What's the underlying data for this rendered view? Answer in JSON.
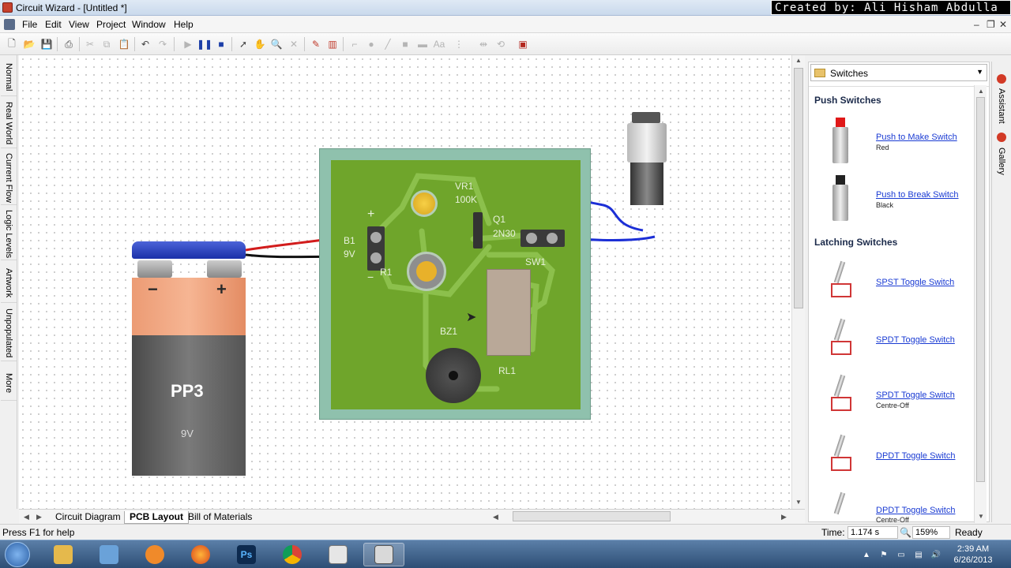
{
  "window": {
    "title": "Circuit Wizard - [Untitled *]",
    "credit": "Created by: Ali Hisham Abdulla"
  },
  "menu": [
    "File",
    "Edit",
    "View",
    "Project",
    "Window",
    "Help"
  ],
  "left_tabs": [
    "Normal",
    "Real World",
    "Current Flow",
    "Logic Levels",
    "Artwork",
    "Unpopulated",
    "More"
  ],
  "canvas": {
    "battery": {
      "model": "PP3",
      "voltage": "9V",
      "minus": "−",
      "plus": "+"
    },
    "pcb_labels": {
      "vr1": "VR1",
      "vr1_value": "100K",
      "q1": "Q1",
      "q1_value": "2N30",
      "b1": "B1",
      "b1_value": "9V",
      "r1": "R1",
      "sw1": "SW1",
      "bz1": "BZ1",
      "rl1": "RL1",
      "plus": "+",
      "minus": "−"
    }
  },
  "bottom_tabs": {
    "circuit": "Circuit Diagram",
    "pcb": "PCB Layout",
    "bom": "Bill of Materials"
  },
  "gallery": {
    "category": "Switches",
    "push_header": "Push Switches",
    "latching_header": "Latching Switches",
    "push_items": [
      {
        "name": "Push to Make Switch",
        "sub": "Red",
        "color": "#e01818"
      },
      {
        "name": "Push to Break Switch",
        "sub": "Black",
        "color": "#222222"
      }
    ],
    "latch_items": [
      {
        "name": "SPST Toggle Switch",
        "sub": ""
      },
      {
        "name": "SPDT Toggle Switch",
        "sub": ""
      },
      {
        "name": "SPDT Toggle Switch",
        "sub": "Centre-Off"
      },
      {
        "name": "DPDT Toggle Switch",
        "sub": ""
      },
      {
        "name": "DPDT Toggle Switch",
        "sub": "Centre-Off"
      }
    ]
  },
  "side_tabs": [
    "Assistant",
    "Gallery"
  ],
  "status": {
    "help": "Press F1 for help",
    "time_label": "Time:",
    "time_value": "1.174 s",
    "zoom": "159%",
    "state": "Ready"
  },
  "taskbar": {
    "time": "2:39 AM",
    "date": "6/26/2013"
  },
  "colors": {
    "accent": "#1a3bd3",
    "pcb_green": "#6fa52b",
    "battery_cap": "#2b40c4"
  }
}
